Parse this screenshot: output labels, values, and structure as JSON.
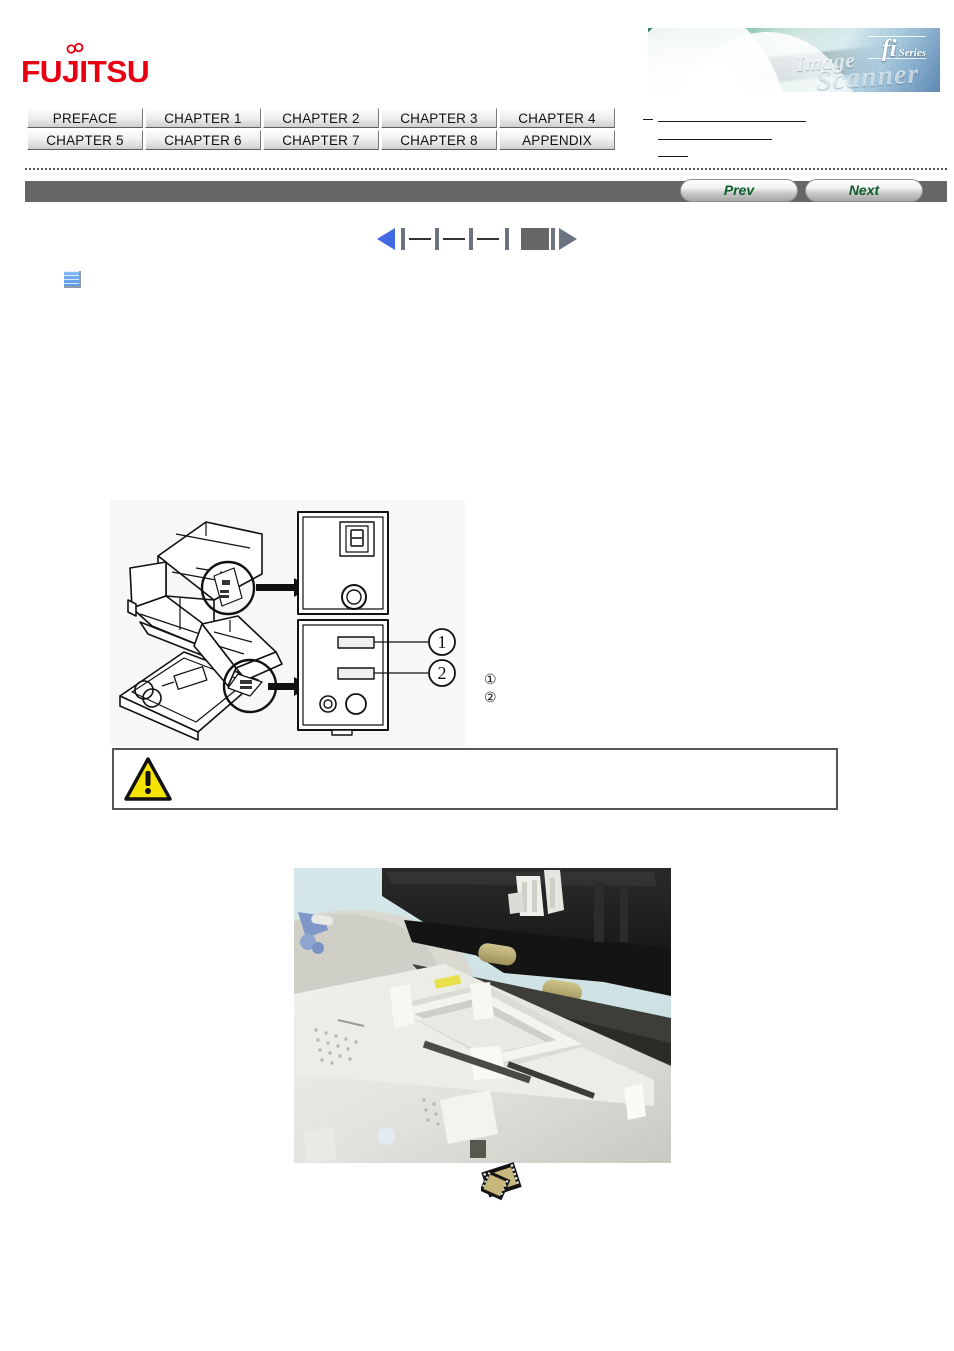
{
  "brand": {
    "logo_text": "FUJITSU",
    "logo_color": "#e60012",
    "banner": {
      "fi_text": "fi",
      "series_text": "Series",
      "image_word": "Image",
      "scanner_word": "Scanner"
    }
  },
  "chapter_nav": {
    "rows": [
      [
        "PREFACE",
        "CHAPTER 1",
        "CHAPTER 2",
        "CHAPTER 3",
        "CHAPTER 4"
      ],
      [
        "CHAPTER 5",
        "CHAPTER 6",
        "CHAPTER 7",
        "CHAPTER 8",
        "APPENDIX"
      ]
    ]
  },
  "side_links": [
    {
      "label": ""
    },
    {
      "label": ""
    },
    {
      "label": ""
    }
  ],
  "pager": {
    "prev_label": "Prev",
    "next_label": "Next",
    "bar_color": "#666666",
    "label_color": "#0c5c2a"
  },
  "step_nav": {
    "back_label": "",
    "forward_label": "",
    "steps": 5,
    "current_step": 5,
    "active_color": "#4169e1",
    "inactive_color": "#6b7280",
    "current_color": "#666666"
  },
  "section": {
    "icon": "blue-square-icon",
    "heading": "",
    "body": ""
  },
  "diagram": {
    "caption": "",
    "callouts": [
      {
        "number": "①",
        "label": ""
      },
      {
        "number": "②",
        "label": ""
      }
    ]
  },
  "caution": {
    "icon": "warning-triangle-icon",
    "text": ""
  },
  "photo": {
    "alt": "scanner-open-rollers-photo"
  },
  "film_link": {
    "icon": "film-strip-icon",
    "label": ""
  }
}
